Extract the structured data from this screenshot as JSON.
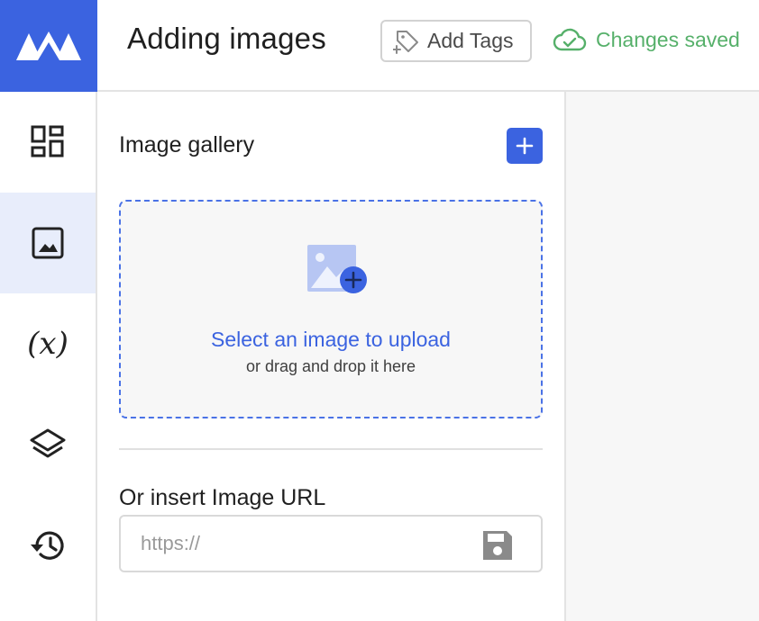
{
  "header": {
    "title": "Adding images",
    "tags_label": "Add Tags",
    "status_label": "Changes saved"
  },
  "colors": {
    "brand": "#3b63e0",
    "success": "#56b06a",
    "active_nav_bg": "#e8edfb"
  },
  "sidebar": {
    "items": [
      {
        "icon": "dashboard-icon",
        "active": false
      },
      {
        "icon": "image-icon",
        "active": true
      },
      {
        "icon": "variable-icon",
        "label": "(x)",
        "active": false
      },
      {
        "icon": "layers-icon",
        "active": false
      },
      {
        "icon": "history-icon",
        "active": false
      }
    ]
  },
  "gallery": {
    "title": "Image gallery",
    "upload_main": "Select an image to upload",
    "upload_sub": "or drag and drop it here"
  },
  "url": {
    "title": "Or insert Image URL",
    "placeholder": "https://"
  }
}
